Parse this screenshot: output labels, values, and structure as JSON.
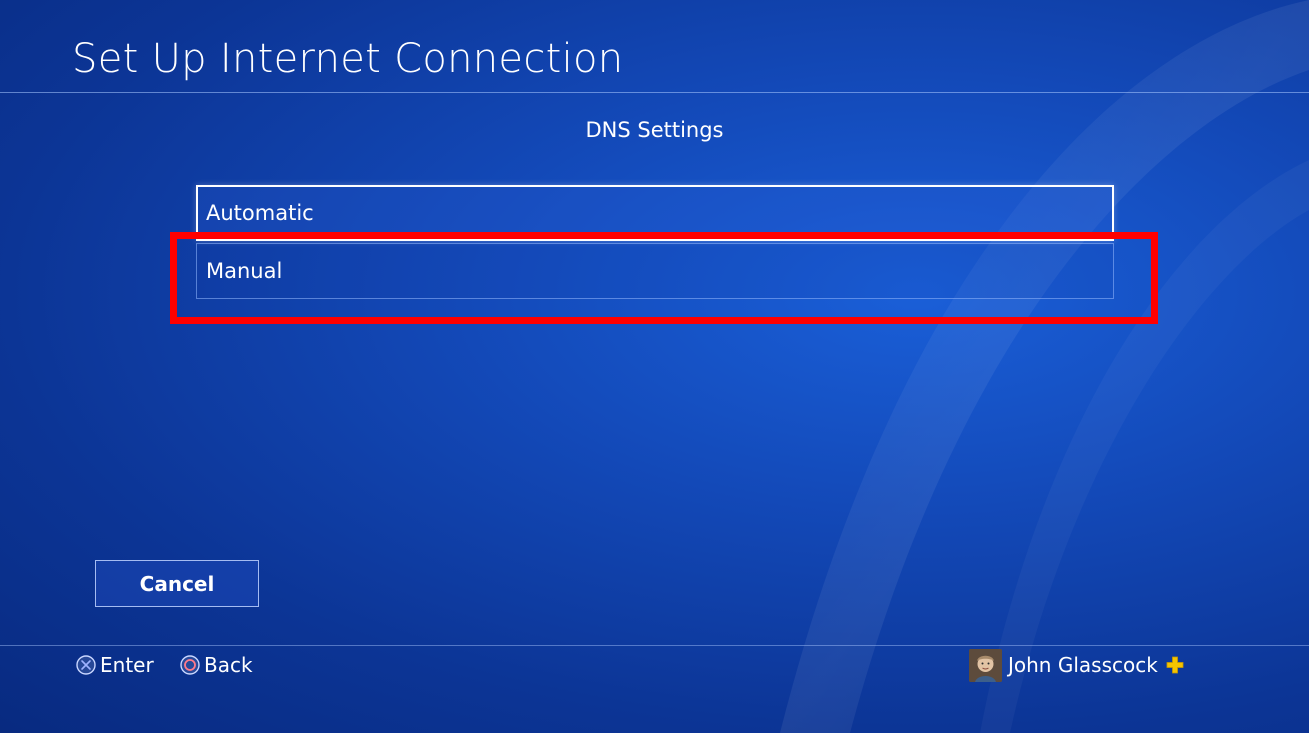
{
  "header": {
    "title": "Set Up Internet Connection"
  },
  "page": {
    "subtitle": "DNS Settings"
  },
  "menu": {
    "items": [
      {
        "label": "Automatic",
        "focused": true
      },
      {
        "label": "Manual",
        "focused": false
      }
    ]
  },
  "buttons": {
    "cancel_label": "Cancel"
  },
  "footer": {
    "enter": {
      "icon": "cross-button-icon",
      "label": "Enter"
    },
    "back": {
      "icon": "circle-button-icon",
      "label": "Back"
    }
  },
  "user": {
    "name": "John Glasscock",
    "avatar_icon": "avatar",
    "plus_icon": "playstation-plus-icon"
  },
  "colors": {
    "background": "#1349b8",
    "highlight_box": "#ff0000",
    "plus": "#f5c400",
    "text": "#ffffff"
  }
}
